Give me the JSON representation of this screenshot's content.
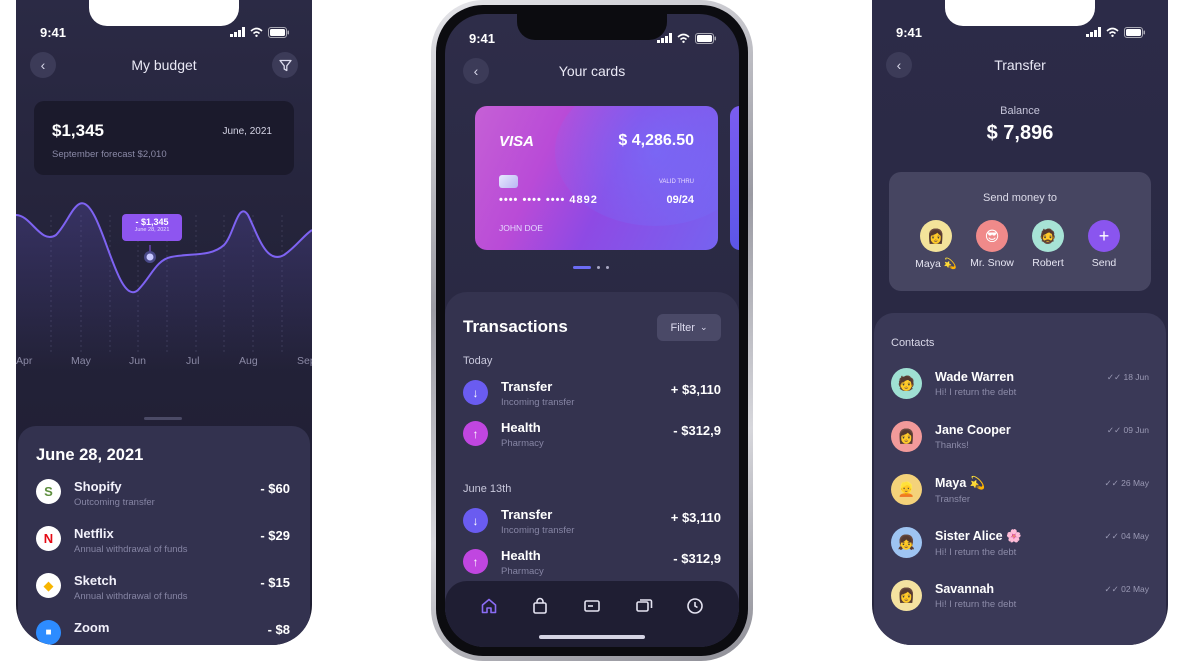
{
  "status_time": "9:41",
  "budget": {
    "title": "My budget",
    "amount": "$1,345",
    "date": "June, 2021",
    "forecast": "September forecast $2,010",
    "tooltip_value": "- $1,345",
    "tooltip_date": "June 28, 2021",
    "months": [
      "Apr",
      "May",
      "Jun",
      "Jul",
      "Aug",
      "Sep"
    ],
    "sheet_title": "June 28, 2021",
    "transactions": [
      {
        "name": "Shopify",
        "sub": "Outcoming transfer",
        "amount": "- $60",
        "icon": "S"
      },
      {
        "name": "Netflix",
        "sub": "Annual withdrawal of funds",
        "amount": "- $29",
        "icon": "N"
      },
      {
        "name": "Sketch",
        "sub": "Annual withdrawal of funds",
        "amount": "- $15",
        "icon": "◆"
      },
      {
        "name": "Zoom",
        "sub": "",
        "amount": "- $8",
        "icon": "■"
      }
    ]
  },
  "cards": {
    "title": "Your cards",
    "brand": "VISA",
    "balance": "$ 4,286.50",
    "valid_label": "VALID THRU",
    "number": "•••• •••• •••• 4892",
    "expiry": "09/24",
    "holder": "JOHN DOE",
    "transactions_title": "Transactions",
    "filter_label": "Filter",
    "groups": [
      {
        "label": "Today",
        "items": [
          {
            "name": "Transfer",
            "sub": "Incoming transfer",
            "amount": "+ $3,110",
            "kind": "in"
          },
          {
            "name": "Health",
            "sub": "Pharmacy",
            "amount": "- $312,9",
            "kind": "out"
          }
        ]
      },
      {
        "label": "June 13th",
        "items": [
          {
            "name": "Transfer",
            "sub": "Incoming transfer",
            "amount": "+ $3,110",
            "kind": "in"
          },
          {
            "name": "Health",
            "sub": "Pharmacy",
            "amount": "- $312,9",
            "kind": "out"
          }
        ]
      }
    ],
    "tabs": [
      "home-icon",
      "bag-icon",
      "card-icon",
      "chat-icon",
      "clock-icon"
    ]
  },
  "transfer": {
    "title": "Transfer",
    "balance_label": "Balance",
    "balance": "$ 7,896",
    "send_title": "Send money to",
    "recipients": [
      "Maya 💫",
      "Mr. Snow",
      "Robert",
      "Send"
    ],
    "contacts_title": "Contacts",
    "contacts": [
      {
        "name": "Wade Warren",
        "sub": "Hi! I return the debt",
        "date": "18 Jun"
      },
      {
        "name": "Jane Cooper",
        "sub": "Thanks!",
        "date": "09 Jun"
      },
      {
        "name": "Maya 💫",
        "sub": "Transfer",
        "date": "26 May"
      },
      {
        "name": "Sister Alice 🌸",
        "sub": "Hi! I return the debt",
        "date": "04 May"
      },
      {
        "name": "Savannah",
        "sub": "Hi! I return the debt",
        "date": "02 May"
      }
    ]
  },
  "colors": {
    "accent_purple": "#8e55f0",
    "accent_blue": "#6c6cf5",
    "in_icon": "#6a5cf0",
    "out_icon": "#c046e0"
  }
}
